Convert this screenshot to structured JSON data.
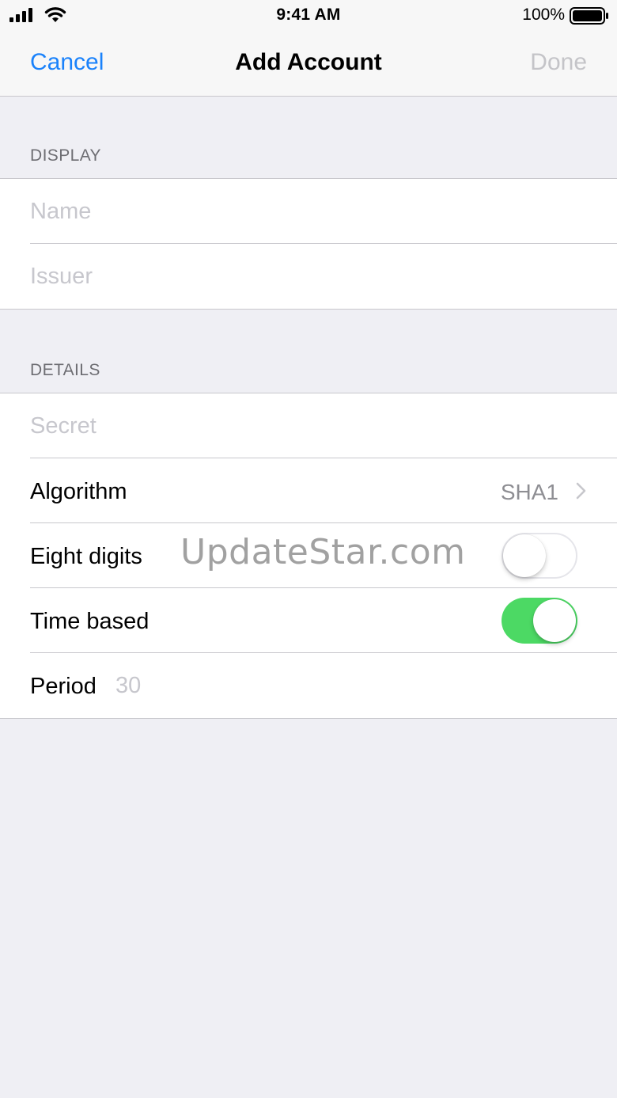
{
  "status_bar": {
    "time": "9:41 AM",
    "battery_percent": "100%",
    "icons": [
      "signal-icon",
      "wifi-icon",
      "battery-icon"
    ]
  },
  "nav": {
    "cancel_label": "Cancel",
    "title": "Add Account",
    "done_label": "Done"
  },
  "display_section": {
    "header": "DISPLAY",
    "name_placeholder": "Name",
    "issuer_placeholder": "Issuer"
  },
  "details_section": {
    "header": "DETAILS",
    "secret_placeholder": "Secret",
    "algorithm_label": "Algorithm",
    "algorithm_value": "SHA1",
    "eight_digits_label": "Eight digits",
    "eight_digits_on": false,
    "time_based_label": "Time based",
    "time_based_on": true,
    "period_label": "Period",
    "period_placeholder": "30"
  },
  "watermark": "UpdateStar.com",
  "colors": {
    "accent": "#1a82fb",
    "switch_on": "#4cd964",
    "disabled": "#c4c4c8",
    "background": "#efeff4"
  }
}
